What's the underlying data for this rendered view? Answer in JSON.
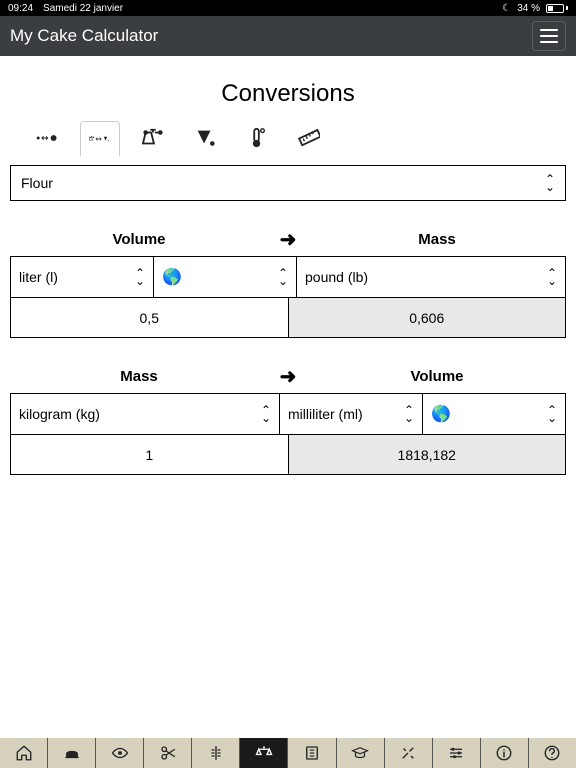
{
  "status": {
    "time": "09:24",
    "date": "Samedi 22 janvier",
    "battery": "34 %"
  },
  "header": {
    "title": "My Cake Calculator"
  },
  "page": {
    "title": "Conversions"
  },
  "ingredient": {
    "selected": "Flour"
  },
  "section1": {
    "left_header": "Volume",
    "right_header": "Mass",
    "unit_left": "liter (l)",
    "unit_right": "pound (lb)",
    "value_left": "0,5",
    "value_right": "0,606"
  },
  "section2": {
    "left_header": "Mass",
    "right_header": "Volume",
    "unit_left": "kilogram (kg)",
    "unit_right": "milliliter (ml)",
    "value_left": "1",
    "value_right": "1818,182"
  },
  "icons": {
    "globe": "🌎"
  }
}
